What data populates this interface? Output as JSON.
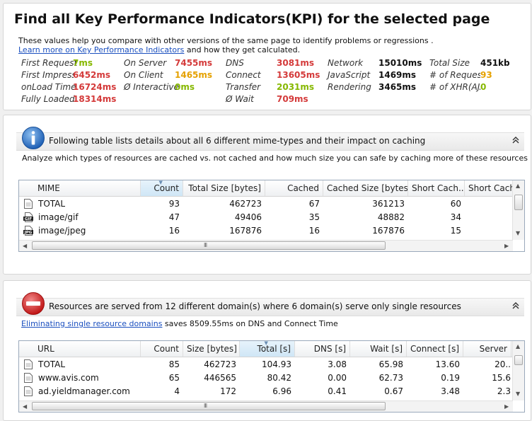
{
  "kpi": {
    "title": "Find all Key Performance Indicators(KPI) for the selected page",
    "line1": "These values help you compare with other versions of the same page to identify problems or regressions .",
    "learn_link": "Learn more on Key Performance Indicators",
    "line2_rest": " and how they get calculated.",
    "items": [
      {
        "label": "First Request",
        "value": "7ms",
        "color": "green"
      },
      {
        "label": "First Impressi",
        "value": "6452ms",
        "color": "red"
      },
      {
        "label": "onLoad Time",
        "value": "16724ms",
        "color": "red"
      },
      {
        "label": "Fully Loaded",
        "value": "18314ms",
        "color": "red"
      },
      {
        "label": "On Server",
        "value": "7455ms",
        "color": "red"
      },
      {
        "label": "On Client",
        "value": "1465ms",
        "color": "orange"
      },
      {
        "label": "Ø Interactive",
        "value": "0ms",
        "color": "green"
      },
      {
        "label": "DNS",
        "value": "3081ms",
        "color": "red"
      },
      {
        "label": "Connect",
        "value": "13605ms",
        "color": "red"
      },
      {
        "label": "Transfer",
        "value": "2031ms",
        "color": "green"
      },
      {
        "label": "Ø Wait",
        "value": "709ms",
        "color": "red"
      },
      {
        "label": "Network",
        "value": "15010ms",
        "color": "black"
      },
      {
        "label": "JavaScript",
        "value": "1469ms",
        "color": "black"
      },
      {
        "label": "Rendering",
        "value": "3465ms",
        "color": "black"
      },
      {
        "label": "Total Size",
        "value": "451kb",
        "color": "black"
      },
      {
        "label": "# of Requests",
        "value": "93",
        "color": "orange"
      },
      {
        "label": "# of XHR(AJA",
        "value": "0",
        "color": "green"
      }
    ]
  },
  "mime_section": {
    "header": "Following table lists details about all 6 different mime-types and their impact on caching",
    "collapse_glyph": "⌃",
    "description": "Analyze which types of resources are cached vs. not cached and how much size you can safe by caching more of these resources",
    "columns": [
      "MIME",
      "Count",
      "Total Size [bytes]",
      "Cached",
      "Cached Size [bytes]",
      "Short Cach...",
      "Short Cach"
    ],
    "rows": [
      {
        "icon": "page",
        "cells": [
          "TOTAL",
          "93",
          "462723",
          "67",
          "361213",
          "60",
          ""
        ]
      },
      {
        "icon": "gif",
        "cells": [
          "image/gif",
          "47",
          "49406",
          "35",
          "48882",
          "34",
          ""
        ]
      },
      {
        "icon": "jpg",
        "cells": [
          "image/jpeg",
          "16",
          "167876",
          "16",
          "167876",
          "15",
          ""
        ]
      }
    ]
  },
  "domain_section": {
    "header": "Resources are served from 12 different domain(s) where 6 domain(s) serve only single resources",
    "collapse_glyph": "⌃",
    "link": "Eliminating single resource domains",
    "link_rest": " saves 8509.55ms on DNS and Connect Time",
    "columns": [
      "URL",
      "Count",
      "Size [bytes]",
      "Total [s]",
      "DNS [s]",
      "Wait [s]",
      "Connect [s]",
      "Server"
    ],
    "rows": [
      {
        "cells": [
          "TOTAL",
          "85",
          "462723",
          "104.93",
          "3.08",
          "65.98",
          "13.60",
          "20.."
        ]
      },
      {
        "cells": [
          "www.avis.com",
          "65",
          "446565",
          "80.42",
          "0.00",
          "62.73",
          "0.19",
          "15.6"
        ]
      },
      {
        "cells": [
          "ad.yieldmanager.com",
          "4",
          "172",
          "6.96",
          "0.41",
          "0.67",
          "3.48",
          "2.3"
        ]
      }
    ]
  },
  "scroll": {
    "grip": "III"
  }
}
